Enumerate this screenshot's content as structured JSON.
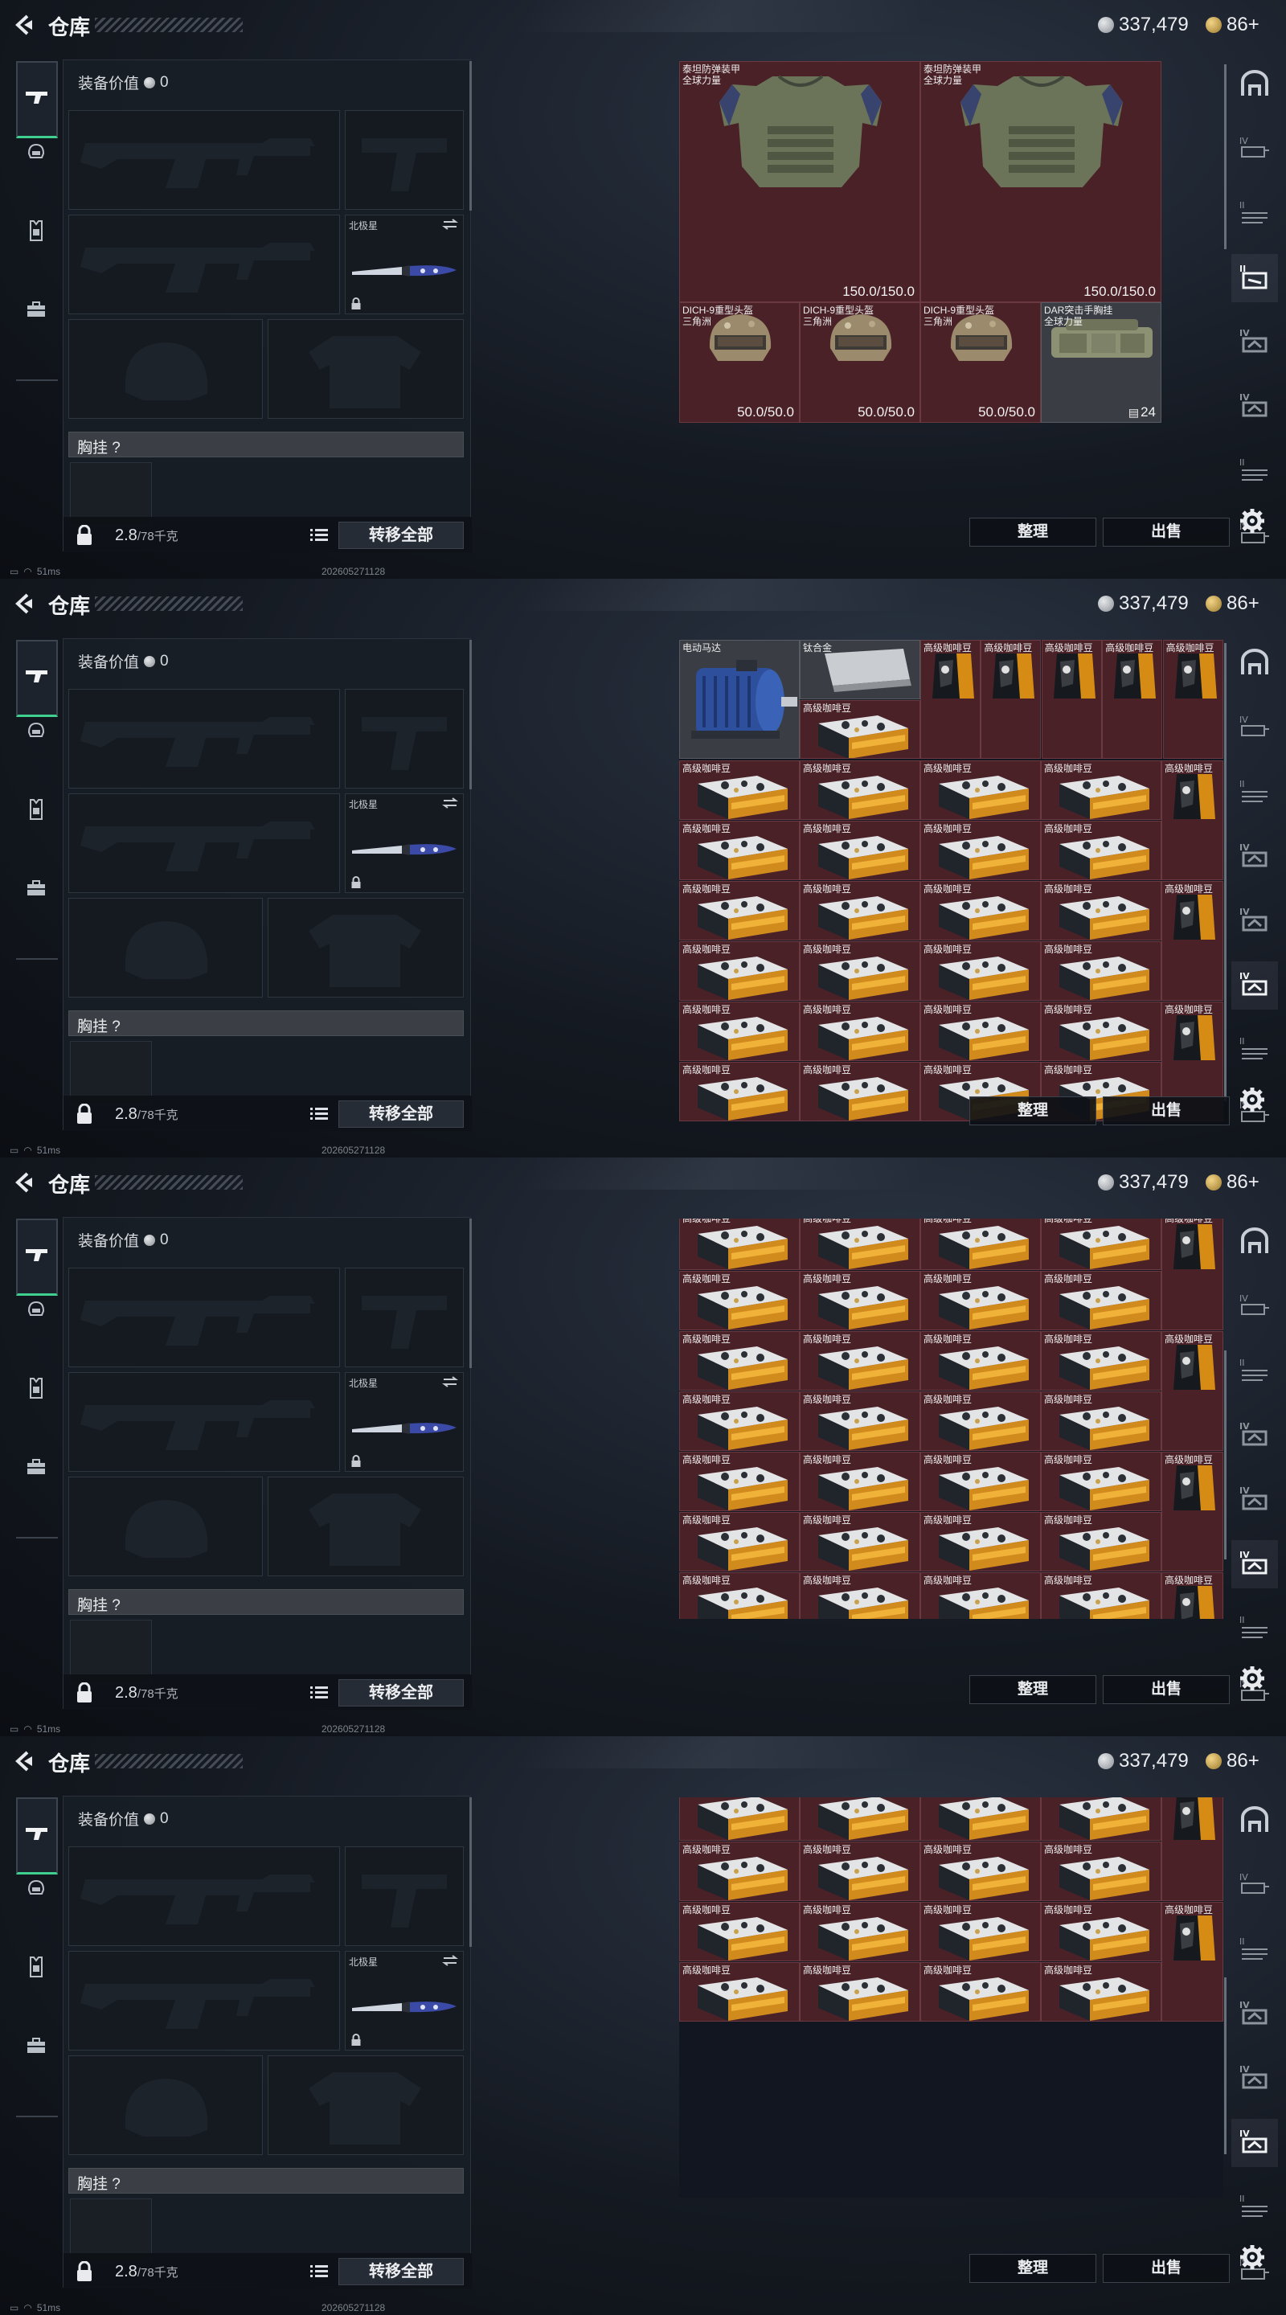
{
  "header": {
    "title": "仓库",
    "silver_amount": "337,479",
    "gold_amount": "86+"
  },
  "equipment": {
    "value_label": "装备价值",
    "value": "0",
    "knife_label": "北极星",
    "chest_label": "胸挂 ?",
    "weight_value": "2.8",
    "weight_unit": "/78千克",
    "transfer_all": "转移全部"
  },
  "actions": {
    "sort": "整理",
    "sell": "出售"
  },
  "status": {
    "ping": "51ms",
    "build": "202605271128"
  },
  "storage_items": {
    "armor_name": "泰坦防弹装甲",
    "armor_sub": "全球力量",
    "armor_dur": "150.0/150.0",
    "helmet_name": "DICH-9重型头盔",
    "helmet_sub": "三角洲",
    "helmet_dur": "50.0/50.0",
    "rig_name": "DAR突击手胸挂",
    "rig_sub": "全球力量",
    "rig_count": "24",
    "motor_name": "电动马达",
    "titanium_name": "钛合金",
    "coffee_name": "高级咖啡豆"
  },
  "colors": {
    "accent_green": "#3fd090",
    "cell_red": "#4a2127",
    "cell_gray": "#3a3e44"
  }
}
